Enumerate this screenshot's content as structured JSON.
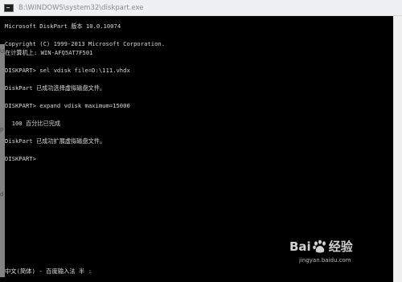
{
  "window": {
    "title": "B:\\WINDOWS\\system32\\diskpart.exe"
  },
  "console": {
    "lines": [
      "Microsoft DiskPart 版本 10.0.10074",
      "",
      "Copyright (C) 1999-2013 Microsoft Corporation.",
      "在计算机上: WIN-AFQ5AT7F501",
      "",
      "DISKPART> sel vdisk file=D:\\111.vhdx",
      "",
      "DiskPart 已成功选择虚拟磁盘文件。",
      "",
      "DISKPART> expand vdisk maximum=15000",
      "",
      "  100 百分比已完成",
      "",
      "DiskPart 已成功扩展虚拟磁盘文件。",
      "",
      "DISKPART>"
    ]
  },
  "side_marks": [
    "U",
    "p",
    "d"
  ],
  "ime": {
    "status": "中文(简体) - 百度输入法 半 :"
  },
  "watermark": {
    "brand_left": "Bai",
    "brand_right": "经验",
    "url": "jingyan.baidu.com",
    "paw_icon": "baidu-paw-icon"
  },
  "colors": {
    "console_bg": "#000000",
    "console_text": "#d9d9d9",
    "titlebar_bg": "#eef0f2"
  }
}
